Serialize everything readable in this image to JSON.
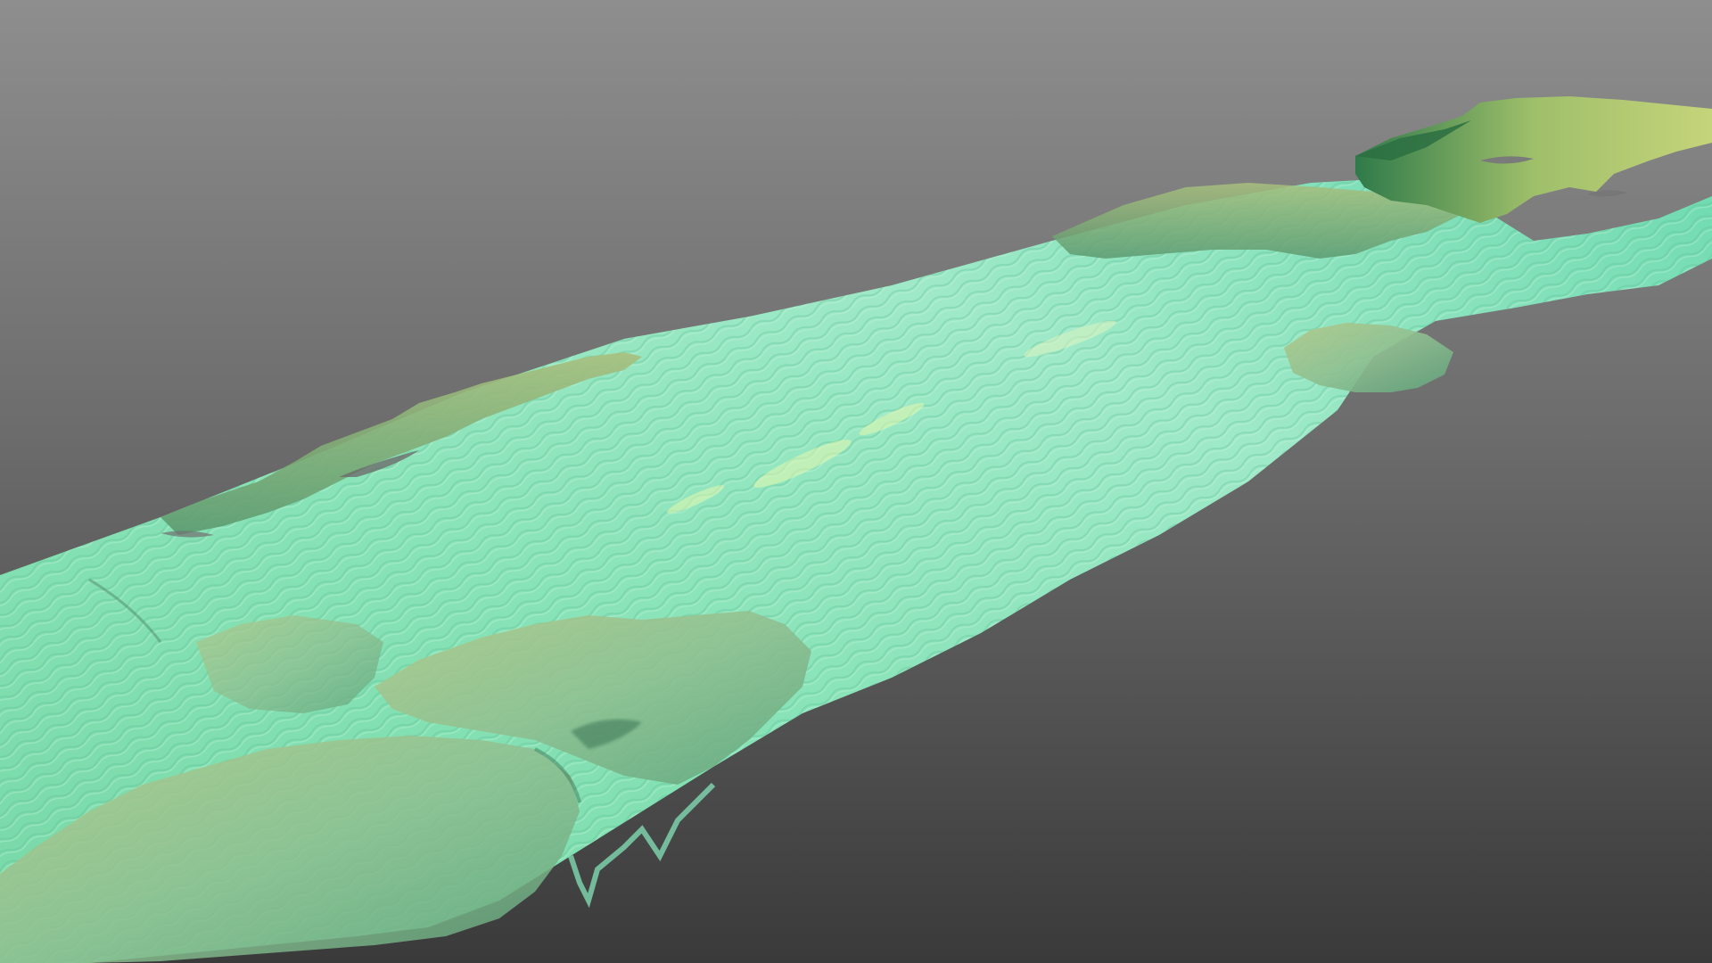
{
  "viewport": {
    "background_top_color": "#8e8e8e",
    "background_bottom_color": "#3a3a3a"
  },
  "model": {
    "subject": "photogrammetry-3d-reef-seabed-strip",
    "colors": {
      "water_teal": "#7fe0b4",
      "sand_light": "#a9ecc8",
      "rock_green": "#7fb08a",
      "rock_olive": "#9fb77a",
      "rock_yellow": "#c9d27c",
      "shadow_green": "#3f7a5a"
    }
  }
}
